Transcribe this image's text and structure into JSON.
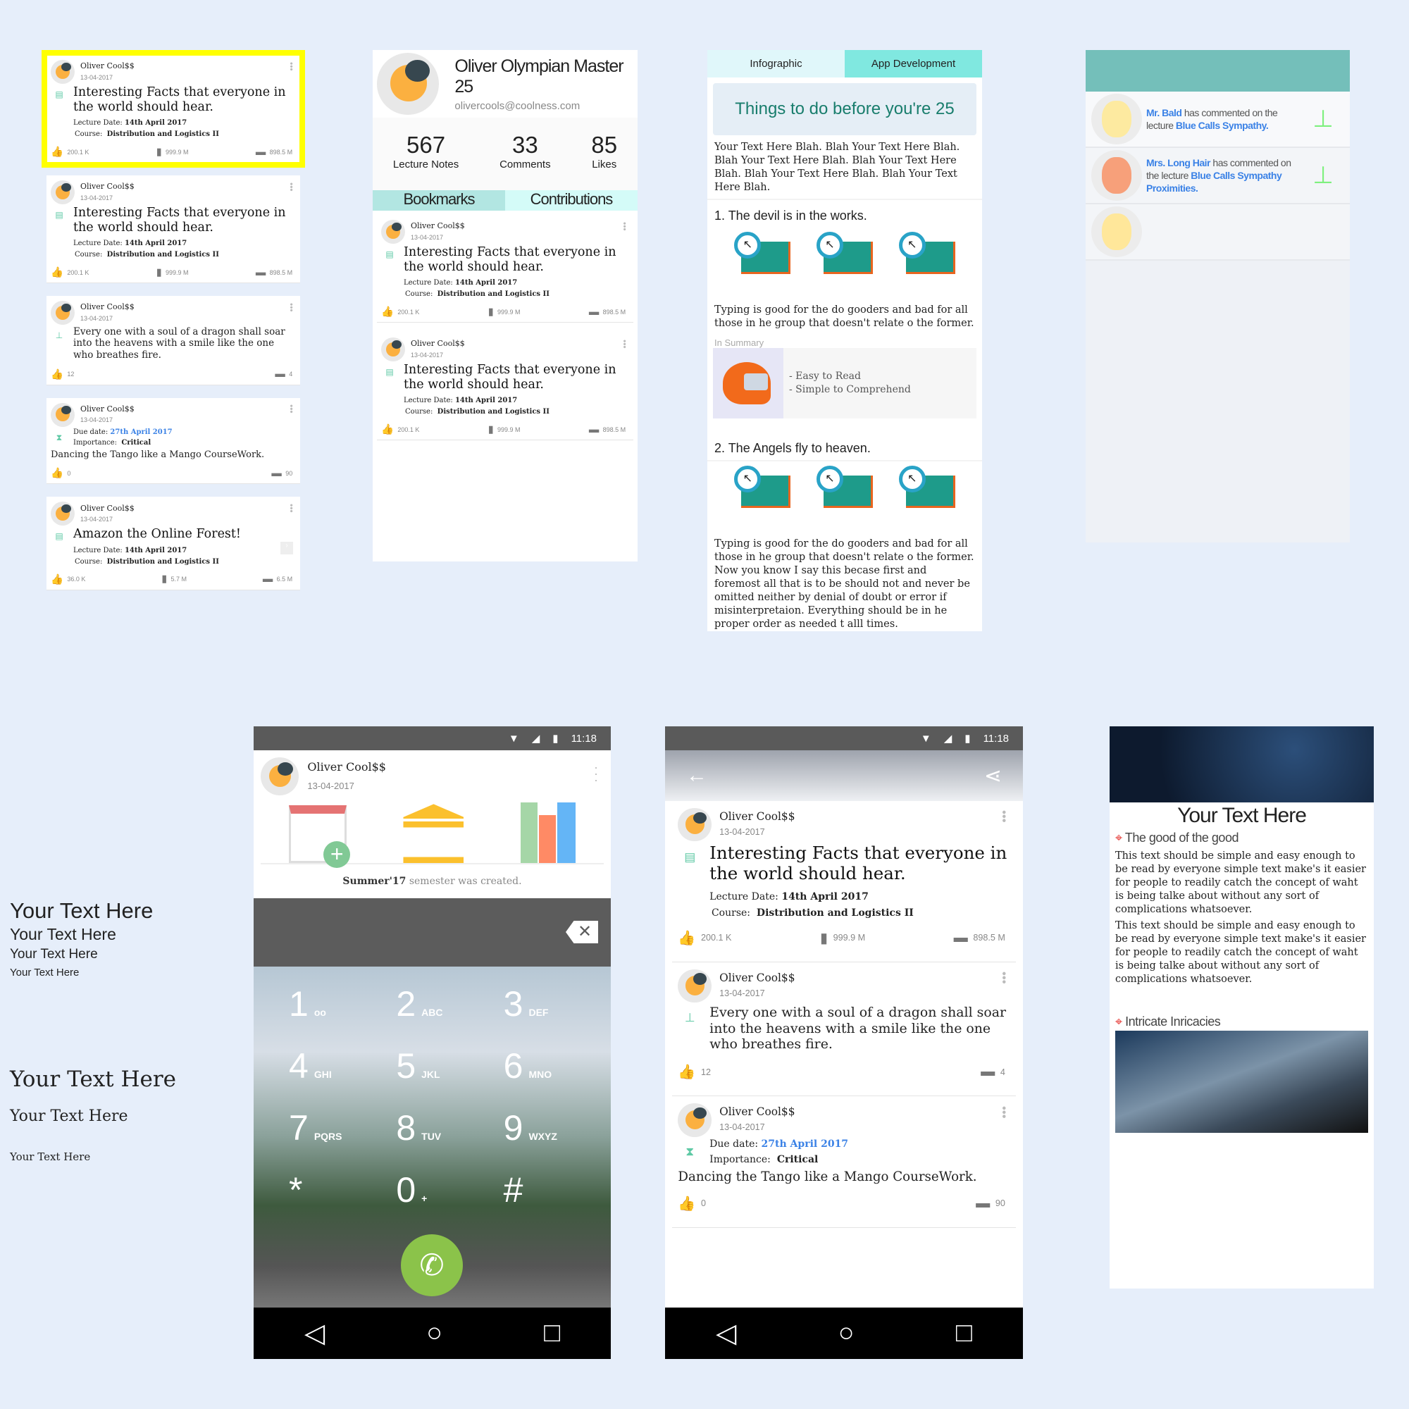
{
  "colors": {
    "accent": "#5fc9a5",
    "highlight": "#ffff00",
    "link": "#3b82e6",
    "teal": "#74bfba",
    "green": "#7ef07e"
  },
  "feed_cards": [
    {
      "type": "lecture",
      "name": "Oliver Cool$$",
      "date": "13-04-2017",
      "title": "Interesting Facts that everyone in the world should hear.",
      "lecture_label": "Lecture Date:",
      "lecture_date": "14th April 2017",
      "course_label": "Course:",
      "course": "Distribution and Logistics II",
      "likes": "200.1 K",
      "bookmarks": "999.9 M",
      "comments": "898.5 M",
      "selected": true
    },
    {
      "type": "lecture",
      "name": "Oliver Cool$$",
      "date": "13-04-2017",
      "title": "Interesting Facts that everyone in the world should hear.",
      "lecture_label": "Lecture Date:",
      "lecture_date": "14th April 2017",
      "course_label": "Course:",
      "course": "Distribution and Logistics II",
      "likes": "200.1 K",
      "bookmarks": "999.9 M",
      "comments": "898.5 M"
    },
    {
      "type": "post",
      "name": "Oliver Cool$$",
      "date": "13-04-2017",
      "text": "Every one with a soul of a dragon shall soar into the heavens with a smile like the one who breathes fire.",
      "likes": "12",
      "comments": "4"
    },
    {
      "type": "task",
      "name": "Oliver Cool$$",
      "date": "13-04-2017",
      "due_label": "Due date:",
      "due": "27th April 2017",
      "importance_label": "Importance:",
      "importance": "Critical",
      "text": "Dancing the Tango like  a Mango CourseWork.",
      "likes": "0",
      "comments": "90"
    },
    {
      "type": "lecture",
      "name": "Oliver Cool$$",
      "date": "13-04-2017",
      "title": "Amazon the Online Forest!",
      "lecture_label": "Lecture Date:",
      "lecture_date": "14th April 2017",
      "course_label": "Course:",
      "course": "Distribution and Logistics II",
      "likes": "36.0 K",
      "bookmarks": "5.7 M",
      "comments": "6.5 M",
      "arrow": true
    }
  ],
  "profile": {
    "name": "Oliver Olympian Master",
    "level": "25",
    "email": "olivercools@coolness.com",
    "stats": [
      {
        "value": "567",
        "label": "Lecture Notes"
      },
      {
        "value": "33",
        "label": "Comments"
      },
      {
        "value": "85",
        "label": "Likes"
      }
    ],
    "tabs": [
      {
        "label": "Bookmarks",
        "active": true
      },
      {
        "label": "Contributions"
      }
    ],
    "cards": [
      {
        "type": "lecture",
        "name": "Oliver Cool$$",
        "date": "13-04-2017",
        "title": "Interesting Facts that everyone in the world should hear.",
        "lecture_label": "Lecture Date:",
        "lecture_date": "14th April 2017",
        "course_label": "Course:",
        "course": "Distribution and Logistics II",
        "likes": "200.1 K",
        "bookmarks": "999.9 M",
        "comments": "898.5 M"
      },
      {
        "type": "lecture",
        "name": "Oliver Cool$$",
        "date": "13-04-2017",
        "title": "Interesting Facts that everyone in the world should hear.",
        "lecture_label": "Lecture Date:",
        "lecture_date": "14th April 2017",
        "course_label": "Course:",
        "course": "Distribution and Logistics II",
        "likes": "200.1 K",
        "bookmarks": "999.9 M",
        "comments": "898.5 M"
      }
    ]
  },
  "infographic": {
    "tabs": [
      {
        "label": "Infographic"
      },
      {
        "label": "App Development",
        "active": true
      }
    ],
    "title": "Things to do before you're 25",
    "intro": "Your Text Here Blah. Blah Your Text Here Blah. Blah Your Text Here Blah. Blah Your Text Here Blah. Blah Your Text Here Blah. Blah Your Text Here Blah.",
    "item1": "1. The devil is in the works.",
    "text1": "Typing is good for the do gooders and bad for all those in he group that doesn't relate o the former.",
    "summary_label": "In Summary",
    "summary_points": [
      "- Easy to Read",
      "- Simple to Comprehend"
    ],
    "item2": "2. The Angels fly to heaven.",
    "text2": "Typing is good for the do gooders and bad for all those in he group that doesn't relate o the former. Now you know I say this becase first and foremost all that is to be should not and never be omitted neither by denial of doubt or error if misinterpretaion. Everything should be in he proper order as needed t alll times."
  },
  "notifications": [
    {
      "user": "Mr. Bald",
      "mid": " has commented on the lecture ",
      "lecture": "Blue Calls Sympathy."
    },
    {
      "user": "Mrs. Long Hair",
      "mid": " has commented on the lecture ",
      "lecture": "Blue Calls Sympathy Proximities."
    },
    {
      "user": "",
      "mid": "",
      "lecture": ""
    }
  ],
  "type_samples": {
    "sans": [
      "Your Text Here",
      "Your Text Here",
      "Your Text Here",
      "Your Text Here"
    ],
    "serif": [
      "Your Text Here",
      "Your Text Here",
      "Your Text Here"
    ]
  },
  "dialer": {
    "time": "11:18",
    "name": "Oliver Cool$$",
    "date": "13-04-2017",
    "event_bold": "Summer'17",
    "event_rest": " semester was created.",
    "keys": [
      [
        "1",
        "oo"
      ],
      [
        "2",
        "ABC"
      ],
      [
        "3",
        "DEF"
      ],
      [
        "4",
        "GHI"
      ],
      [
        "5",
        "JKL"
      ],
      [
        "6",
        "MNO"
      ],
      [
        "7",
        "PQRS"
      ],
      [
        "8",
        "TUV"
      ],
      [
        "9",
        "WXYZ"
      ],
      [
        "*",
        ""
      ],
      [
        "0",
        "+"
      ],
      [
        "#",
        ""
      ]
    ]
  },
  "feed_phone": {
    "time": "11:18",
    "cards": [
      {
        "type": "lecture",
        "name": "Oliver Cool$$",
        "date": "13-04-2017",
        "title": "Interesting Facts that everyone in the world should hear.",
        "lecture_label": "Lecture Date:",
        "lecture_date": "14th April 2017",
        "course_label": "Course:",
        "course": "Distribution and Logistics II",
        "likes": "200.1 K",
        "bookmarks": "999.9 M",
        "comments": "898.5 M"
      },
      {
        "type": "post",
        "name": "Oliver Cool$$",
        "date": "13-04-2017",
        "text": "Every one with a soul of a dragon shall soar into the heavens with a smile like the one who breathes fire.",
        "likes": "12",
        "comments": "4"
      },
      {
        "type": "task",
        "name": "Oliver Cool$$",
        "date": "13-04-2017",
        "due_label": "Due date:",
        "due": "27th April 2017",
        "importance_label": "Importance:",
        "importance": "Critical",
        "text": "Dancing the Tango like  a Mango CourseWork.",
        "likes": "0",
        "comments": "90"
      }
    ]
  },
  "article": {
    "title": "Your Text Here",
    "section1": "The good of the good",
    "paragraphs": [
      "This text should be simple and easy enough to be read by everyone simple text make's it easier for people to readily catch the concept of waht is being talke about without any sort of complications whatsoever.",
      "This text should be simple and easy enough to be read by everyone simple text make's it easier for people to readily catch the concept of waht is being talke about without any sort of complications whatsoever."
    ],
    "section2": "Intricate Inricacies"
  }
}
